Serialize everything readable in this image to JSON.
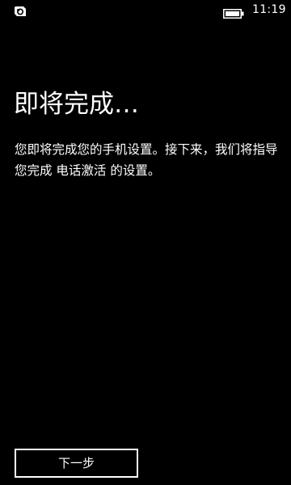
{
  "status_bar": {
    "time": "11:19",
    "signal_icon": "signal-icon",
    "battery_icon": "battery-icon"
  },
  "page": {
    "title": "即将完成…",
    "description": "您即将完成您的手机设置。接下来，我们将指导您完成 电话激活 的设置。"
  },
  "actions": {
    "next_label": "下一步"
  }
}
